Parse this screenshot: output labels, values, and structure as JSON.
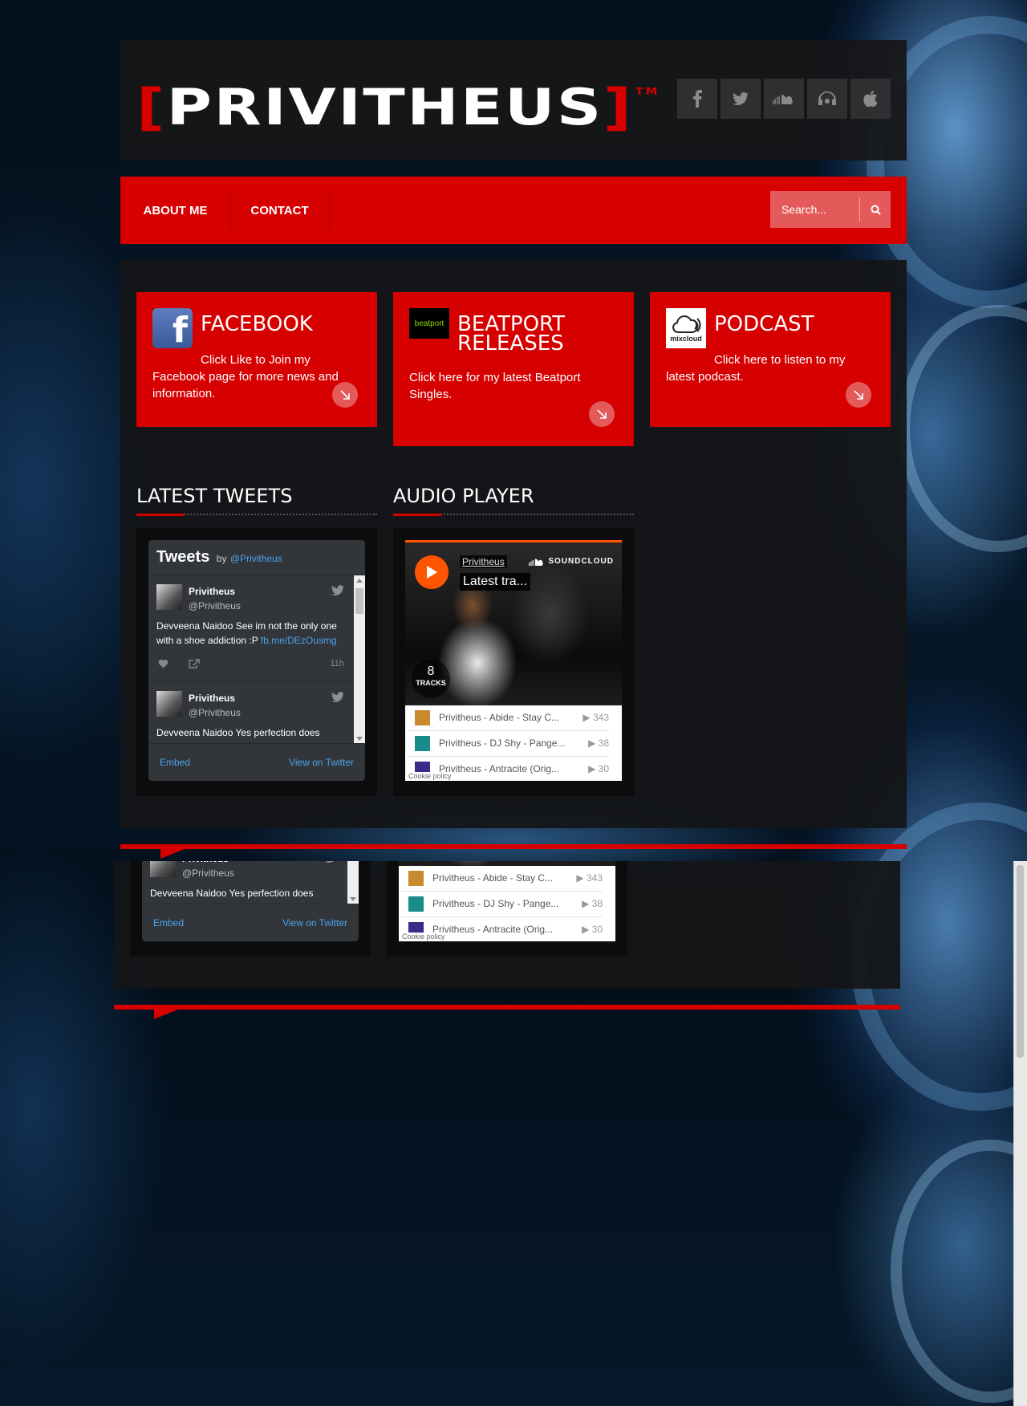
{
  "brand": {
    "logo_left": "[",
    "logo_text": "PRIVITHEUS",
    "logo_right": "]",
    "logo_tm": "TM",
    "accent": "#d70000"
  },
  "social": [
    {
      "name": "facebook",
      "icon": "facebook-icon"
    },
    {
      "name": "twitter",
      "icon": "twitter-icon"
    },
    {
      "name": "soundcloud",
      "icon": "soundcloud-icon"
    },
    {
      "name": "mixcloud",
      "icon": "headphones-icon"
    },
    {
      "name": "apple",
      "icon": "apple-icon"
    }
  ],
  "nav": {
    "items": [
      {
        "label": "ABOUT ME"
      },
      {
        "label": "CONTACT"
      }
    ],
    "search_placeholder": "Search..."
  },
  "cards": [
    {
      "title": "FACEBOOK",
      "desc": "Click Like to Join my Facebook page for more news and information.",
      "icon": "facebook-logo-icon"
    },
    {
      "title": "BEATPORT RELEASES",
      "desc": "Click here for my latest Beatport Singles.",
      "icon": "beatport-logo-icon",
      "icon_text": "beatport"
    },
    {
      "title": "PODCAST",
      "desc": "Click here to listen to my latest podcast.",
      "icon": "mixcloud-logo-icon",
      "icon_text": "mixcloud"
    }
  ],
  "sections": {
    "tweets_title": "LATEST TWEETS",
    "audio_title": "AUDIO PLAYER"
  },
  "twitter": {
    "title": "Tweets",
    "by": "by",
    "handle": "@Privitheus",
    "tweets": [
      {
        "name": "Privitheus",
        "user": "@Privitheus",
        "text": "Devveena Naidoo See im not the only one with a shoe addiction :P ",
        "link": "fb.me/DEzOusmg",
        "time": "11h"
      },
      {
        "name": "Privitheus",
        "user": "@Privitheus",
        "text": "Devveena Naidoo Yes perfection does",
        "link": "",
        "time": ""
      }
    ],
    "embed": "Embed",
    "view": "View on Twitter"
  },
  "soundcloud": {
    "artist": "Privitheus",
    "track": "Latest tra...",
    "brand": "SOUNDCLOUD",
    "count": "8",
    "count_label": "TRACKS",
    "tracks": [
      {
        "title": "Privitheus - Abide - Stay C...",
        "plays": "343",
        "thumb_color": "#c98a2d"
      },
      {
        "title": "Privitheus - DJ Shy - Pange...",
        "plays": "38",
        "thumb_color": "#1a8a8a"
      },
      {
        "title": "Privitheus - Antracite (Orig...",
        "plays": "30",
        "thumb_color": "#3a2a8a"
      }
    ],
    "cookie": "Cookie policy",
    "accent": "#ff5500"
  }
}
